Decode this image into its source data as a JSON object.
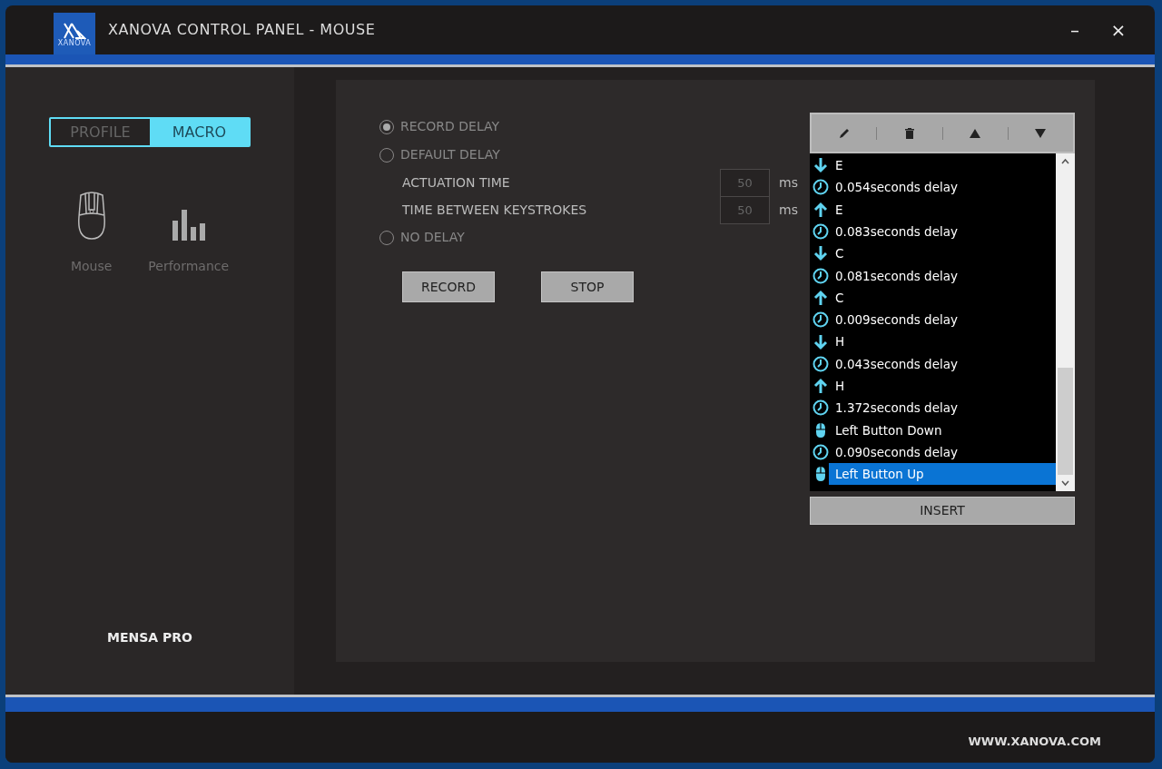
{
  "window": {
    "title": "XANOVA CONTROL PANEL - MOUSE",
    "logo_text": "XANOVA",
    "controls": [
      "–",
      "×"
    ]
  },
  "mode_tabs": [
    {
      "label": "PROFILE",
      "selected": false
    },
    {
      "label": "MACRO",
      "selected": true
    }
  ],
  "sidebar": {
    "items": [
      {
        "label": "Mouse",
        "kind": "mouse"
      },
      {
        "label": "Performance",
        "kind": "performance"
      }
    ],
    "device": "MENSA PRO"
  },
  "delay_options": [
    {
      "label": "RECORD DELAY",
      "selected": true
    },
    {
      "label": "DEFAULT DELAY",
      "selected": false,
      "fields": [
        {
          "label": "ACTUATION TIME",
          "value": "50",
          "unit": "ms"
        },
        {
          "label": "TIME BETWEEN KEYSTROKES",
          "value": "50",
          "unit": "ms"
        }
      ]
    },
    {
      "label": "NO DELAY",
      "selected": false
    }
  ],
  "buttons": [
    "RECORD",
    "STOP"
  ],
  "macro_toolbar": [
    {
      "kind": "edit"
    },
    {
      "kind": "delete"
    },
    {
      "kind": "up"
    },
    {
      "kind": "down"
    }
  ],
  "macro_list": [
    {
      "kind": "key_down",
      "text": "E",
      "selected": false
    },
    {
      "kind": "delay",
      "text": "0.054seconds delay",
      "selected": false
    },
    {
      "kind": "key_up",
      "text": "E",
      "selected": false
    },
    {
      "kind": "delay",
      "text": "0.083seconds delay",
      "selected": false
    },
    {
      "kind": "key_down",
      "text": "C",
      "selected": false
    },
    {
      "kind": "delay",
      "text": "0.081seconds delay",
      "selected": false
    },
    {
      "kind": "key_up",
      "text": "C",
      "selected": false
    },
    {
      "kind": "delay",
      "text": "0.009seconds delay",
      "selected": false
    },
    {
      "kind": "key_down",
      "text": "H",
      "selected": false
    },
    {
      "kind": "delay",
      "text": "0.043seconds delay",
      "selected": false
    },
    {
      "kind": "key_up",
      "text": "H",
      "selected": false
    },
    {
      "kind": "delay",
      "text": "1.372seconds delay",
      "selected": false
    },
    {
      "kind": "mouse",
      "text": "Left Button Down",
      "selected": false
    },
    {
      "kind": "delay",
      "text": "0.090seconds delay",
      "selected": false
    },
    {
      "kind": "mouse",
      "text": "Left Button Up",
      "selected": true
    }
  ],
  "insert_button": "INSERT",
  "footer": {
    "url": "WWW.XANOVA.COM"
  }
}
